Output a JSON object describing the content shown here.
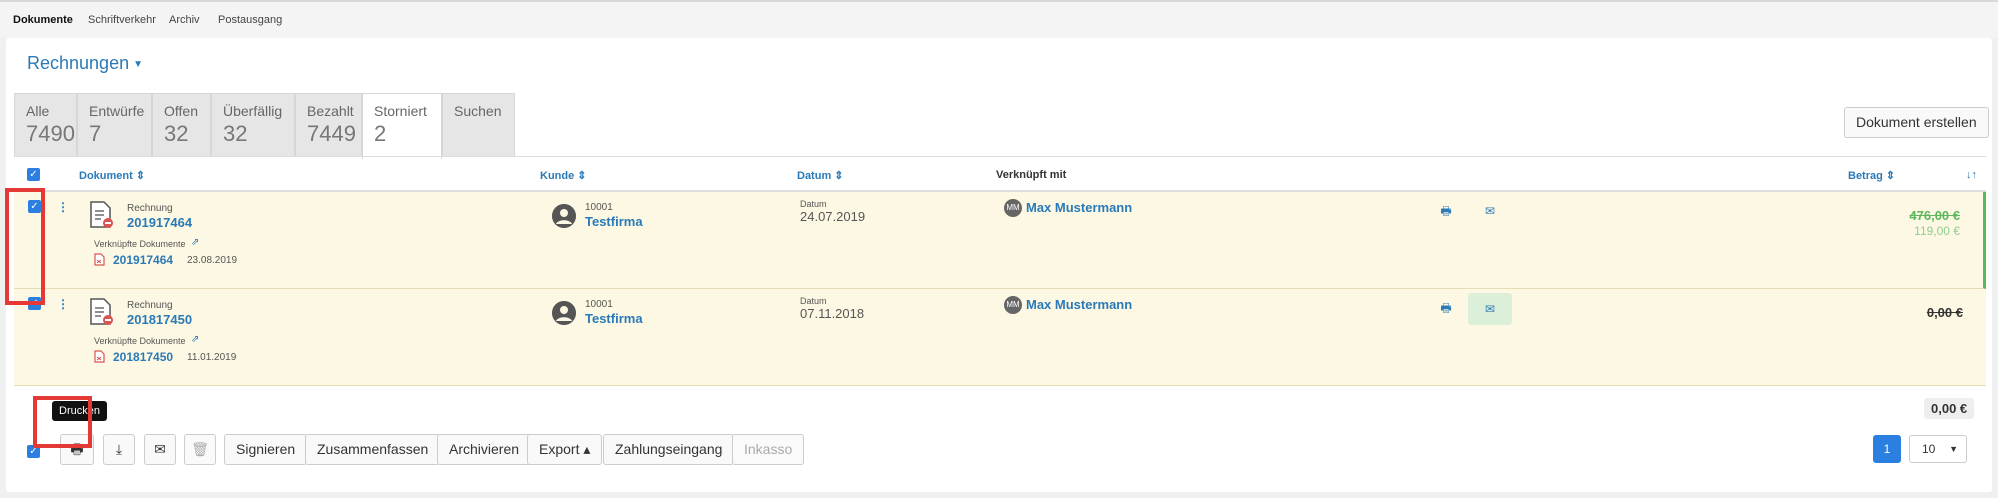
{
  "topnav": {
    "items": [
      "Dokumente",
      "Schriftverkehr",
      "Archiv",
      "Postausgang"
    ]
  },
  "header": {
    "title": "Rechnungen",
    "create_button": "Dokument erstellen"
  },
  "tabs": [
    {
      "label": "Alle",
      "count": "7490"
    },
    {
      "label": "Entwürfe",
      "count": "7"
    },
    {
      "label": "Offen",
      "count": "32"
    },
    {
      "label": "Überfällig",
      "count": "32"
    },
    {
      "label": "Bezahlt",
      "count": "7449"
    },
    {
      "label": "Storniert",
      "count": "2"
    },
    {
      "label": "Suchen",
      "count": ""
    }
  ],
  "table": {
    "columns": {
      "dokument": "Dokument ⇕",
      "kunde": "Kunde ⇕",
      "datum": "Datum ⇕",
      "verknuepft": "Verknüpft mit",
      "betrag": "Betrag ⇕",
      "sort": "↓↑"
    },
    "rows": [
      {
        "doc_type": "Rechnung",
        "doc_number": "201917464",
        "linked_label": "Verknüpfte Dokumente",
        "linked_number": "201917464",
        "linked_date": "23.08.2019",
        "customer_id": "10001",
        "customer_name": "Testfirma",
        "date_label": "Datum",
        "date": "24.07.2019",
        "contact_initials": "MM",
        "contact": "Max Mustermann",
        "amount": "476,00 €",
        "amount_sub": "119,00 €"
      },
      {
        "doc_type": "Rechnung",
        "doc_number": "201817450",
        "linked_label": "Verknüpfte Dokumente",
        "linked_number": "201817450",
        "linked_date": "11.01.2019",
        "customer_id": "10001",
        "customer_name": "Testfirma",
        "date_label": "Datum",
        "date": "07.11.2018",
        "contact_initials": "MM",
        "contact": "Max Mustermann",
        "amount": "0,00 €",
        "amount_sub": ""
      }
    ],
    "total": "0,00 €"
  },
  "actions": {
    "tooltip": "Drucken",
    "buttons": [
      "Signieren",
      "Zusammenfassen",
      "Archivieren",
      "Export ▴",
      "Zahlungseingang",
      "Inkasso"
    ]
  },
  "pagination": {
    "page": "1",
    "per_page": "10"
  },
  "colors": {
    "accent": "#2a7ab8",
    "highlight_row": "#fdf8e3",
    "checkbox": "#2b7fe0",
    "annotation": "#e53935",
    "amount_green": "#5cb85c"
  }
}
